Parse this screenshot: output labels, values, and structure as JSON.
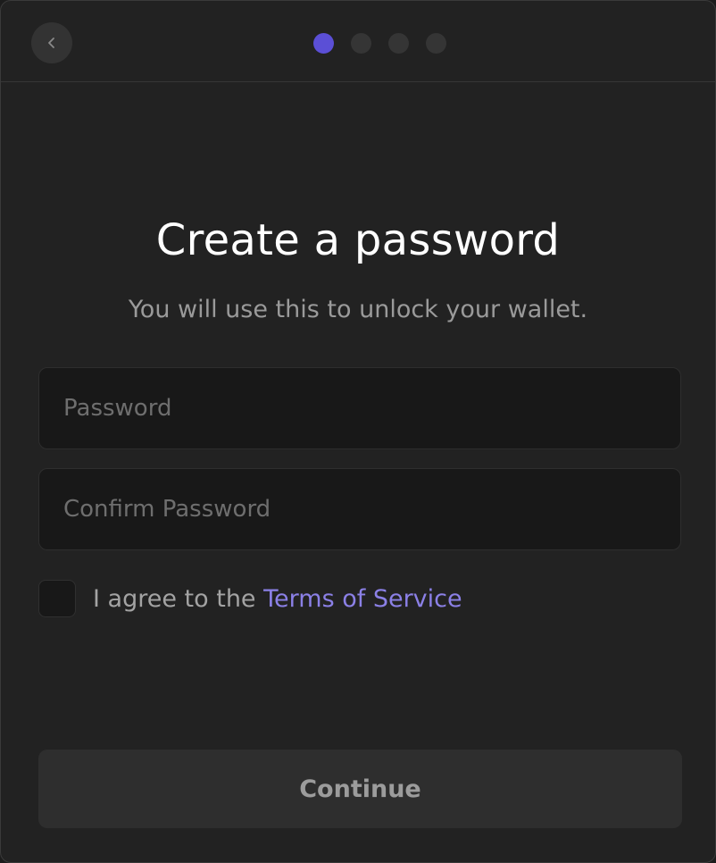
{
  "header": {
    "back_icon": "chevron-left-icon",
    "steps": [
      {
        "active": true
      },
      {
        "active": false
      },
      {
        "active": false
      },
      {
        "active": false
      }
    ],
    "active_color": "#5b4fd6",
    "inactive_color": "#353535"
  },
  "main": {
    "title": "Create a password",
    "subtitle": "You will use this to unlock your wallet.",
    "password_placeholder": "Password",
    "password_value": "",
    "confirm_placeholder": "Confirm Password",
    "confirm_value": "",
    "terms_prefix": "I agree to the ",
    "terms_link": "Terms of Service",
    "terms_checked": false,
    "link_color": "#8b80e6"
  },
  "footer": {
    "continue_label": "Continue"
  }
}
